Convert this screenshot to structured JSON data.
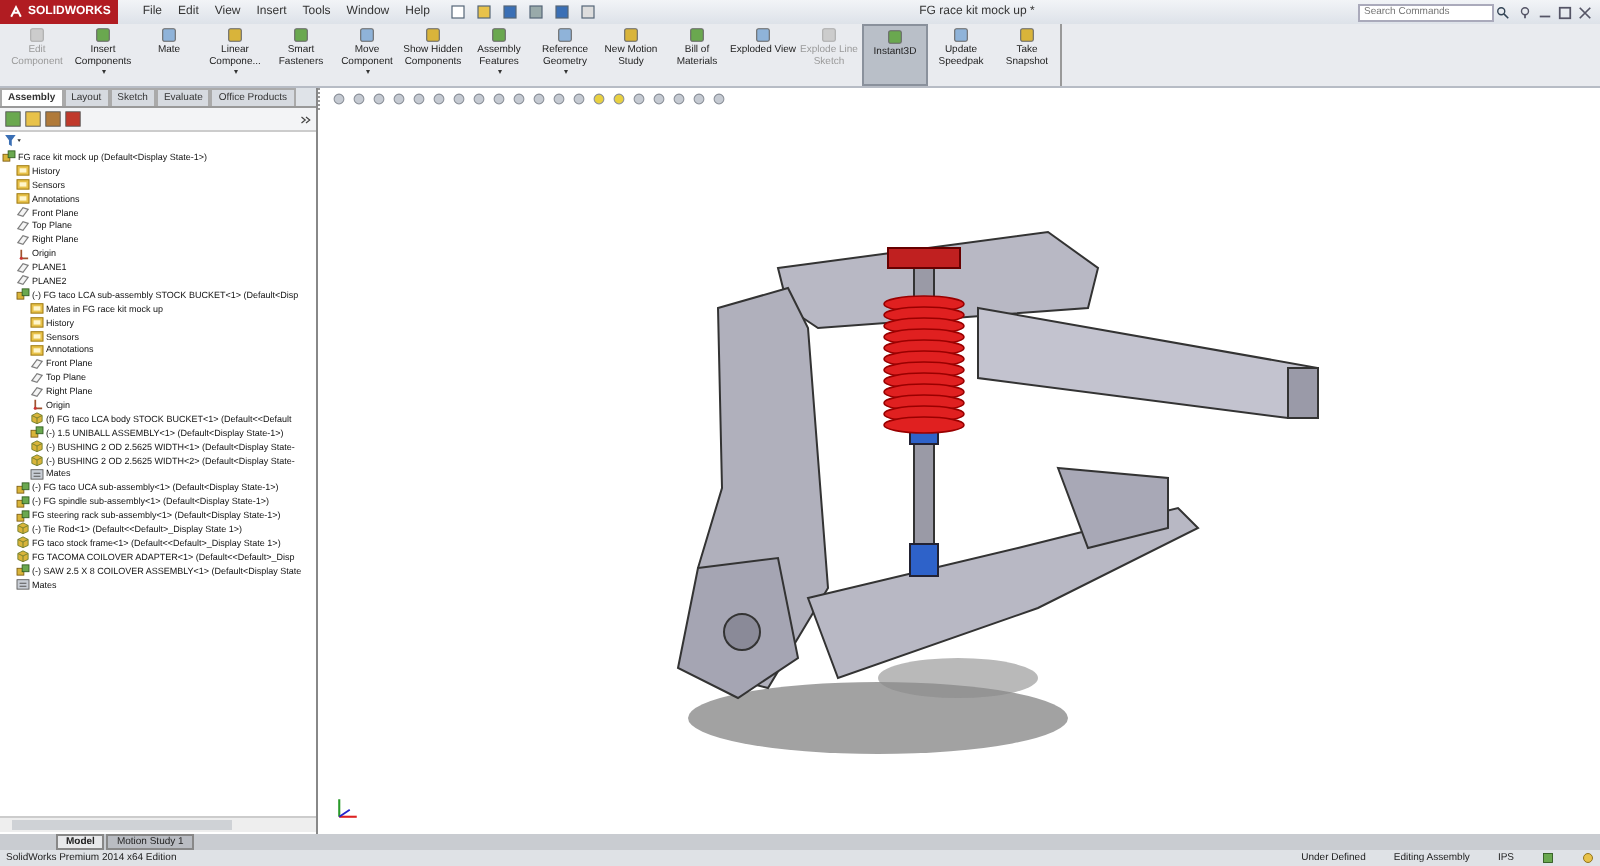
{
  "app": {
    "brand": "SOLIDWORKS",
    "menu": [
      "File",
      "Edit",
      "View",
      "Insert",
      "Tools",
      "Window",
      "Help"
    ],
    "title": "FG race kit mock up *",
    "search": {
      "placeholder": "Search Commands"
    }
  },
  "commands": [
    {
      "label": "Edit Component",
      "disabled": true,
      "selected": false,
      "dropdown": false
    },
    {
      "label": "Insert Components",
      "disabled": false,
      "selected": false,
      "dropdown": true
    },
    {
      "label": "Mate",
      "disabled": false,
      "selected": false,
      "dropdown": false
    },
    {
      "label": "Linear Compone...",
      "disabled": false,
      "selected": false,
      "dropdown": true
    },
    {
      "label": "Smart Fasteners",
      "disabled": false,
      "selected": false,
      "dropdown": false
    },
    {
      "label": "Move Component",
      "disabled": false,
      "selected": false,
      "dropdown": true
    },
    {
      "label": "Show Hidden Components",
      "disabled": false,
      "selected": false,
      "dropdown": false
    },
    {
      "label": "Assembly Features",
      "disabled": false,
      "selected": false,
      "dropdown": true
    },
    {
      "label": "Reference Geometry",
      "disabled": false,
      "selected": false,
      "dropdown": true
    },
    {
      "label": "New Motion Study",
      "disabled": false,
      "selected": false,
      "dropdown": false
    },
    {
      "label": "Bill of Materials",
      "disabled": false,
      "selected": false,
      "dropdown": false
    },
    {
      "label": "Exploded View",
      "disabled": false,
      "selected": false,
      "dropdown": false
    },
    {
      "label": "Explode Line Sketch",
      "disabled": true,
      "selected": false,
      "dropdown": false
    },
    {
      "label": "Instant3D",
      "disabled": false,
      "selected": true,
      "dropdown": false
    },
    {
      "label": "Update Speedpak",
      "disabled": false,
      "selected": false,
      "dropdown": false
    },
    {
      "label": "Take Snapshot",
      "disabled": false,
      "selected": false,
      "dropdown": false
    }
  ],
  "tabs": [
    {
      "label": "Assembly",
      "selected": true
    },
    {
      "label": "Layout",
      "selected": false
    },
    {
      "label": "Sketch",
      "selected": false
    },
    {
      "label": "Evaluate",
      "selected": false
    },
    {
      "label": "Office Products",
      "selected": false
    }
  ],
  "tree": [
    {
      "label": "FG race kit mock up  (Default<Display State-1>)",
      "kind": "assembly",
      "children": [
        {
          "label": "History",
          "kind": "folder"
        },
        {
          "label": "Sensors",
          "kind": "folder"
        },
        {
          "label": "Annotations",
          "kind": "folder"
        },
        {
          "label": "Front Plane",
          "kind": "plane"
        },
        {
          "label": "Top Plane",
          "kind": "plane"
        },
        {
          "label": "Right Plane",
          "kind": "plane"
        },
        {
          "label": "Origin",
          "kind": "origin"
        },
        {
          "label": "PLANE1",
          "kind": "plane"
        },
        {
          "label": "PLANE2",
          "kind": "plane"
        },
        {
          "label": "(-) FG taco LCA sub-assembly STOCK BUCKET<1> (Default<Disp",
          "kind": "assembly",
          "children": [
            {
              "label": "Mates in FG race kit mock up",
              "kind": "folder"
            },
            {
              "label": "History",
              "kind": "folder"
            },
            {
              "label": "Sensors",
              "kind": "folder"
            },
            {
              "label": "Annotations",
              "kind": "folder"
            },
            {
              "label": "Front Plane",
              "kind": "plane"
            },
            {
              "label": "Top Plane",
              "kind": "plane"
            },
            {
              "label": "Right Plane",
              "kind": "plane"
            },
            {
              "label": "Origin",
              "kind": "origin"
            },
            {
              "label": "(f) FG taco LCA body STOCK BUCKET<1> (Default<<Default",
              "kind": "part"
            },
            {
              "label": "(-) 1.5 UNIBALL ASSEMBLY<1> (Default<Display State-1>)",
              "kind": "assembly"
            },
            {
              "label": "(-) BUSHING 2 OD 2.5625 WIDTH<1> (Default<Display State-",
              "kind": "part"
            },
            {
              "label": "(-) BUSHING 2 OD 2.5625 WIDTH<2> (Default<Display State-",
              "kind": "part"
            },
            {
              "label": "Mates",
              "kind": "mates"
            }
          ]
        },
        {
          "label": "(-) FG taco UCA sub-assembly<1> (Default<Display State-1>)",
          "kind": "assembly"
        },
        {
          "label": "(-) FG spindle sub-assembly<1> (Default<Display State-1>)",
          "kind": "assembly"
        },
        {
          "label": "FG steering rack sub-assembly<1> (Default<Display State-1>)",
          "kind": "assembly"
        },
        {
          "label": "(-) Tie Rod<1> (Default<<Default>_Display State 1>)",
          "kind": "part"
        },
        {
          "label": "FG taco stock frame<1> (Default<<Default>_Display State 1>)",
          "kind": "part"
        },
        {
          "label": "FG TACOMA COILOVER ADAPTER<1> (Default<<Default>_Disp",
          "kind": "part"
        },
        {
          "label": "(-) SAW 2.5 X 8 COILOVER ASSEMBLY<1> (Default<Display State",
          "kind": "assembly"
        },
        {
          "label": "Mates",
          "kind": "mates"
        }
      ]
    }
  ],
  "bottom_tabs": [
    {
      "label": "Model",
      "selected": true
    },
    {
      "label": "Motion Study 1",
      "selected": false
    }
  ],
  "status_bar": {
    "edition": "SolidWorks Premium 2014 x64 Edition",
    "state": "Under Defined",
    "mode": "Editing Assembly",
    "units": "IPS"
  }
}
